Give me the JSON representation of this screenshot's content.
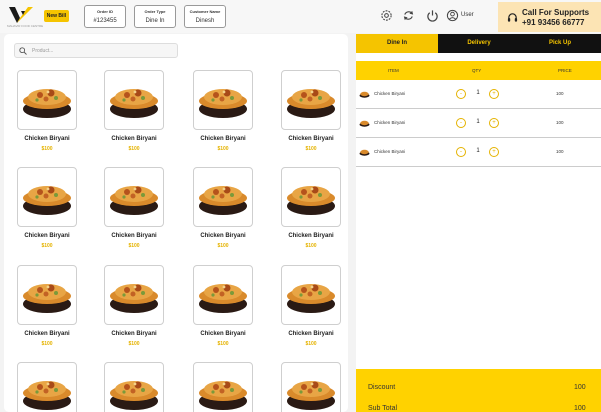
{
  "header": {
    "logo_subtext": "MAHAVIR FOOD CENTRE",
    "new_bill_label": "New Bill",
    "order_id": {
      "label": "Order ID",
      "value": "#123455"
    },
    "order_type": {
      "label": "Order Type",
      "value": "Dine In"
    },
    "customer": {
      "label": "Customer Name",
      "value": "Dinesh"
    },
    "icons": [
      "settings-icon",
      "refresh-icon",
      "power-icon",
      "user-icon"
    ],
    "user_label": "User",
    "support": {
      "title": "Call For Supports",
      "phone": "+91 93456 66777"
    }
  },
  "menu": {
    "search_placeholder": "Product...",
    "items": [
      {
        "name": "Chicken Biryani",
        "price": "$100"
      },
      {
        "name": "Chicken Biryani",
        "price": "$100"
      },
      {
        "name": "Chicken Biryani",
        "price": "$100"
      },
      {
        "name": "Chicken Biryani",
        "price": "$100"
      },
      {
        "name": "Chicken Biryani",
        "price": "$100"
      },
      {
        "name": "Chicken Biryani",
        "price": "$100"
      },
      {
        "name": "Chicken Biryani",
        "price": "$100"
      },
      {
        "name": "Chicken Biryani",
        "price": "$100"
      },
      {
        "name": "Chicken Biryani",
        "price": "$100"
      },
      {
        "name": "Chicken Biryani",
        "price": "$100"
      },
      {
        "name": "Chicken Biryani",
        "price": "$100"
      },
      {
        "name": "Chicken Biryani",
        "price": "$100"
      },
      {
        "name": "",
        "price": ""
      },
      {
        "name": "",
        "price": ""
      },
      {
        "name": "",
        "price": ""
      },
      {
        "name": "",
        "price": ""
      }
    ]
  },
  "order": {
    "tabs": [
      {
        "label": "Dine In",
        "active": true
      },
      {
        "label": "Delivery",
        "active": false
      },
      {
        "label": "Pick Up",
        "active": false
      }
    ],
    "columns": {
      "item": "ITEM",
      "qty": "QTY",
      "price": "PRICE"
    },
    "rows": [
      {
        "name": "Chicken Biryani",
        "qty": "1",
        "price": "100"
      },
      {
        "name": "Chicken Biryani",
        "qty": "1",
        "price": "100"
      },
      {
        "name": "Chicken Biryani",
        "qty": "1",
        "price": "100"
      }
    ],
    "minus_glyph": "-",
    "plus_glyph": "+",
    "summary": {
      "discount_label": "Discount",
      "discount_value": "100",
      "subtotal_label": "Sub Total",
      "subtotal_value": "100"
    }
  },
  "colors": {
    "accent": "#f5c400",
    "accent_light": "#fce4b4",
    "price": "#e5b300",
    "dark": "#111111"
  }
}
